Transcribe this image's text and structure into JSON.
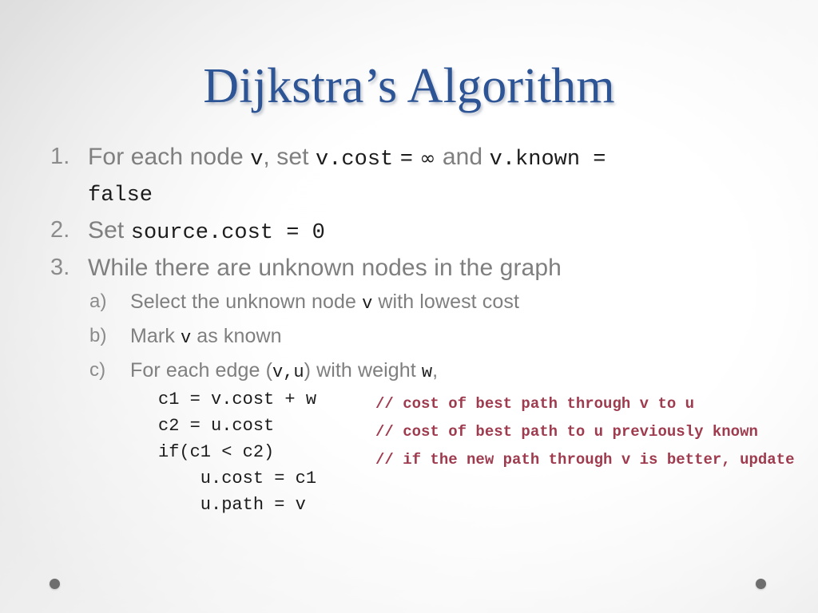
{
  "slide": {
    "title": "Dijkstra’s Algorithm",
    "title_color": "#2d5494",
    "body_color": "#807f7f",
    "code_color": "#1c1c1c",
    "comment_color": "#9e3b4e",
    "background_color": "#f2f2f2"
  },
  "outline": {
    "item1": {
      "marker": "1.",
      "part1": "For each node ",
      "code1": "v",
      "part2": ", set ",
      "code2": "v.cost",
      "part3": " ",
      "code3": "=",
      "part4": " ",
      "infinity": "∞",
      "part5": " and ",
      "code4": "v.known =",
      "code5": "false"
    },
    "item2": {
      "marker": "2.",
      "part1": "Set ",
      "code1": "source.cost = 0"
    },
    "item3": {
      "marker": "3.",
      "text": "While there are unknown nodes in the graph"
    },
    "item3a": {
      "marker": "a)",
      "part1": "Select the unknown node ",
      "code1": "v",
      "part2": " with lowest cost"
    },
    "item3b": {
      "marker": "b)",
      "part1": "Mark ",
      "code1": "v",
      "part2": " as known"
    },
    "item3c": {
      "marker": "c)",
      "part1": "For each edge (",
      "code1": "v,u",
      "part2": ") with weight ",
      "code2": "w",
      "part3": ","
    }
  },
  "code_block": {
    "lines": [
      "c1 = v.cost + w",
      "c2 = u.cost",
      "if(c1 < c2)",
      "    u.cost = c1",
      "    u.path = v"
    ],
    "text": "c1 = v.cost + w\nc2 = u.cost\nif(c1 < c2)\n    u.cost = c1\n    u.path = v"
  },
  "comments": {
    "lines": [
      "// cost of best path through v to u",
      "// cost of best path to u previously known",
      "// if the new path through v is better, update"
    ],
    "text": "// cost of best path through v to u\n// cost of best path to u previously known\n// if the new path through v is better, update"
  },
  "decorations": {
    "dot_left": "●",
    "dot_right": "●"
  }
}
